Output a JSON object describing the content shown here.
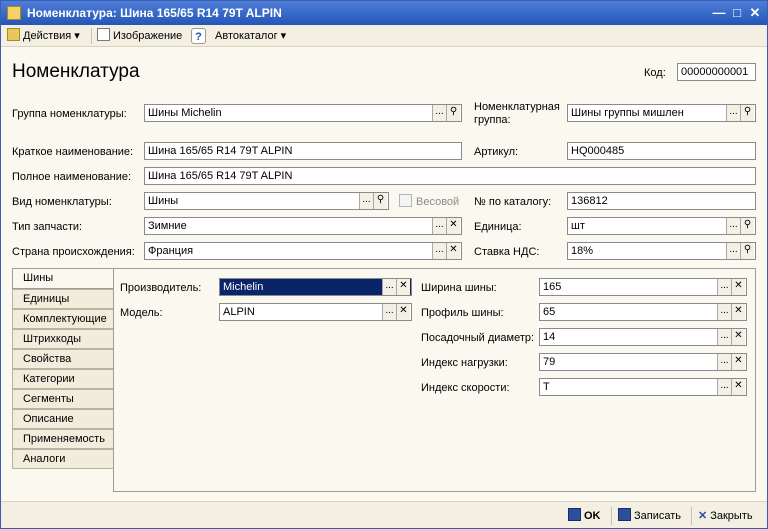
{
  "window": {
    "title": "Номенклатура: Шина 165/65 R14 79T ALPIN"
  },
  "toolbar": {
    "actions": "Действия",
    "image": "Изображение",
    "help": "?",
    "autocatalog": "Автокаталог"
  },
  "header": {
    "title": "Номенклатура",
    "code_label": "Код:",
    "code_value": "00000000001"
  },
  "form": {
    "group_label": "Группа номенклатуры:",
    "group_value": "Шины Michelin",
    "nomen_group_label_1": "Номенклатурная",
    "nomen_group_label_2": "группа:",
    "nomen_group_value": "Шины группы мишлен",
    "short_name_label": "Краткое наименование:",
    "short_name_value": "Шина 165/65 R14 79T ALPIN",
    "article_label": "Артикул:",
    "article_value": "HQ000485",
    "full_name_label": "Полное наименование:",
    "full_name_value": "Шина 165/65 R14 79T ALPIN",
    "kind_label": "Вид номенклатуры:",
    "kind_value": "Шины",
    "weight_label": "Весовой",
    "catalog_label": "№ по каталогу:",
    "catalog_value": "136812",
    "part_type_label": "Тип запчасти:",
    "part_type_value": "Зимние",
    "unit_label": "Единица:",
    "unit_value": "шт",
    "country_label": "Страна происхождения:",
    "country_value": "Франция",
    "vat_label": "Ставка НДС:",
    "vat_value": "18%"
  },
  "tabs": [
    "Шины",
    "Единицы",
    "Комплектующие",
    "Штрихкоды",
    "Свойства",
    "Категории",
    "Сегменты",
    "Описание",
    "Применяемость",
    "Аналоги"
  ],
  "tires": {
    "maker_label": "Производитель:",
    "maker_value": "Michelin",
    "model_label": "Модель:",
    "model_value": "ALPIN",
    "width_label": "Ширина шины:",
    "width_value": "165",
    "profile_label": "Профиль шины:",
    "profile_value": "65",
    "diameter_label": "Посадочный диаметр:",
    "diameter_value": "14",
    "load_label": "Индекс нагрузки:",
    "load_value": "79",
    "speed_label": "Индекс скорости:",
    "speed_value": "T"
  },
  "footer": {
    "ok": "OK",
    "save": "Записать",
    "close": "Закрыть"
  }
}
